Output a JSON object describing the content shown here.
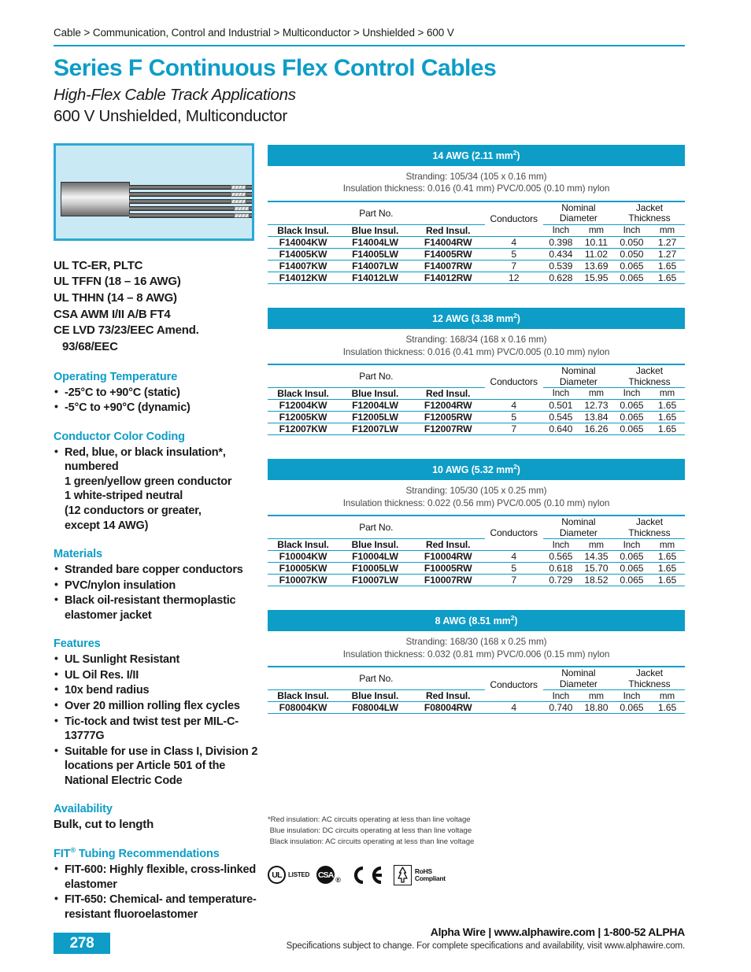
{
  "breadcrumb": "Cable > Communication, Control and Industrial > Multiconductor > Unshielded  > 600 V",
  "title": {
    "main": "Series F Continuous Flex Control Cables",
    "sub1": "High-Flex Cable Track Applications",
    "sub2": "600 V Unshielded, Multiconductor"
  },
  "colors": {
    "accent": "#0d9dc7",
    "image_border": "#2ba9d4",
    "image_bg": "#c9e9f5"
  },
  "sidebar": {
    "approvals": [
      "UL TC-ER, PLTC",
      "UL TFFN (18 – 16 AWG)",
      "UL THHN (14 – 8 AWG)",
      "CSA AWM I/II A/B FT4",
      "CE LVD 73/23/EEC Amend."
    ],
    "approvals_indent": "93/68/EEC",
    "sections": [
      {
        "heading": "Operating Temperature",
        "items": [
          "-25°C to +90°C (static)",
          "-5°C to +90°C (dynamic)"
        ]
      },
      {
        "heading": "Conductor Color Coding",
        "items": [
          "Red, blue, or black insulation*, numbered\n1 green/yellow green conductor\n1 white-striped neutral\n(12 conductors or greater,\nexcept 14 AWG)"
        ]
      },
      {
        "heading": "Materials",
        "items": [
          "Stranded bare copper conductors",
          "PVC/nylon insulation",
          "Black oil-resistant thermoplastic elastomer jacket"
        ]
      },
      {
        "heading": "Features",
        "items": [
          "UL Sunlight Resistant",
          "UL Oil Res. I/II",
          "10x bend radius",
          "Over 20 million rolling flex cycles",
          "Tic-tock and twist test per MIL-C-13777G",
          "Suitable for use in Class I, Division 2 locations per Article 501 of the National Electric Code"
        ]
      }
    ],
    "availability": {
      "heading": "Availability",
      "text": "Bulk, cut to length"
    },
    "fit": {
      "heading": "FIT",
      "heading_sup": "®",
      "heading_rest": " Tubing Recommendations",
      "items": [
        "FIT-600: Highly flexible, cross-linked elastomer",
        "FIT-650: Chemical- and temperature-resistant fluoroelastomer"
      ]
    }
  },
  "table_columns": {
    "group_partno": "Part No.",
    "group_conductors": "Conductors",
    "group_nominal": "Nominal\nDiameter",
    "group_jacket": "Jacket\nThickness",
    "sub_black": "Black Insul.",
    "sub_blue": "Blue Insul.",
    "sub_red": "Red Insul.",
    "sub_inch": "Inch",
    "sub_mm": "mm"
  },
  "awg_tables": [
    {
      "band": "14 AWG (2.11 mm²)",
      "band_main": "14 AWG (2.11 mm",
      "stranding": "Stranding: 105/34 (105 x 0.16 mm)",
      "insulation": "Insulation thickness: 0.016 (0.41 mm) PVC/0.005 (0.10 mm) nylon",
      "rows": [
        {
          "black": "F14004KW",
          "blue": "F14004LW",
          "red": "F14004RW",
          "conductors": "4",
          "dia_in": "0.398",
          "dia_mm": "10.11",
          "jkt_in": "0.050",
          "jkt_mm": "1.27"
        },
        {
          "black": "F14005KW",
          "blue": "F14005LW",
          "red": "F14005RW",
          "conductors": "5",
          "dia_in": "0.434",
          "dia_mm": "11.02",
          "jkt_in": "0.050",
          "jkt_mm": "1.27"
        },
        {
          "black": "F14007KW",
          "blue": "F14007LW",
          "red": "F14007RW",
          "conductors": "7",
          "dia_in": "0.539",
          "dia_mm": "13.69",
          "jkt_in": "0.065",
          "jkt_mm": "1.65"
        },
        {
          "black": "F14012KW",
          "blue": "F14012LW",
          "red": "F14012RW",
          "conductors": "12",
          "dia_in": "0.628",
          "dia_mm": "15.95",
          "jkt_in": "0.065",
          "jkt_mm": "1.65"
        }
      ]
    },
    {
      "band": "12 AWG (3.38 mm²)",
      "band_main": "12 AWG (3.38 mm",
      "stranding": "Stranding: 168/34 (168 x 0.16 mm)",
      "insulation": "Insulation thickness: 0.016 (0.41 mm) PVC/0.005 (0.10 mm) nylon",
      "rows": [
        {
          "black": "F12004KW",
          "blue": "F12004LW",
          "red": "F12004RW",
          "conductors": "4",
          "dia_in": "0.501",
          "dia_mm": "12.73",
          "jkt_in": "0.065",
          "jkt_mm": "1.65"
        },
        {
          "black": "F12005KW",
          "blue": "F12005LW",
          "red": "F12005RW",
          "conductors": "5",
          "dia_in": "0.545",
          "dia_mm": "13.84",
          "jkt_in": "0.065",
          "jkt_mm": "1.65"
        },
        {
          "black": "F12007KW",
          "blue": "F12007LW",
          "red": "F12007RW",
          "conductors": "7",
          "dia_in": "0.640",
          "dia_mm": "16.26",
          "jkt_in": "0.065",
          "jkt_mm": "1.65"
        }
      ]
    },
    {
      "band": "10 AWG (5.32 mm²)",
      "band_main": "10 AWG (5.32 mm",
      "stranding": "Stranding: 105/30 (105 x 0.25 mm)",
      "insulation": "Insulation thickness: 0.022 (0.56 mm) PVC/0.005 (0.10 mm) nylon",
      "rows": [
        {
          "black": "F10004KW",
          "blue": "F10004LW",
          "red": "F10004RW",
          "conductors": "4",
          "dia_in": "0.565",
          "dia_mm": "14.35",
          "jkt_in": "0.065",
          "jkt_mm": "1.65"
        },
        {
          "black": "F10005KW",
          "blue": "F10005LW",
          "red": "F10005RW",
          "conductors": "5",
          "dia_in": "0.618",
          "dia_mm": "15.70",
          "jkt_in": "0.065",
          "jkt_mm": "1.65"
        },
        {
          "black": "F10007KW",
          "blue": "F10007LW",
          "red": "F10007RW",
          "conductors": "7",
          "dia_in": "0.729",
          "dia_mm": "18.52",
          "jkt_in": "0.065",
          "jkt_mm": "1.65"
        }
      ]
    },
    {
      "band": "8 AWG (8.51 mm²)",
      "band_main": "8 AWG (8.51 mm",
      "stranding": "Stranding: 168/30 (168 x 0.25 mm)",
      "insulation": "Insulation thickness: 0.032 (0.81 mm) PVC/0.006 (0.15 mm) nylon",
      "rows": [
        {
          "black": "F08004KW",
          "blue": "F08004LW",
          "red": "F08004RW",
          "conductors": "4",
          "dia_in": "0.740",
          "dia_mm": "18.80",
          "jkt_in": "0.065",
          "jkt_mm": "1.65"
        }
      ]
    }
  ],
  "footnotes": [
    "*Red insulation: AC circuits operating at less than line voltage",
    " Blue insulation: DC circuits operating at less than line voltage",
    " Black insulation: AC circuits operating at less than line voltage"
  ],
  "logos": {
    "ul_text": "UL",
    "ul_listed": "LISTED",
    "csa_text": "CSA",
    "csa_dot": "®",
    "rohs_line1": "RoHS",
    "rohs_line2": "Compliant"
  },
  "footer": {
    "page_number": "278",
    "brand": "Alpha Wire | www.alphawire.com | 1-800-52 ALPHA",
    "note": "Specifications subject to change. For complete specifications and availability, visit www.alphawire.com."
  }
}
